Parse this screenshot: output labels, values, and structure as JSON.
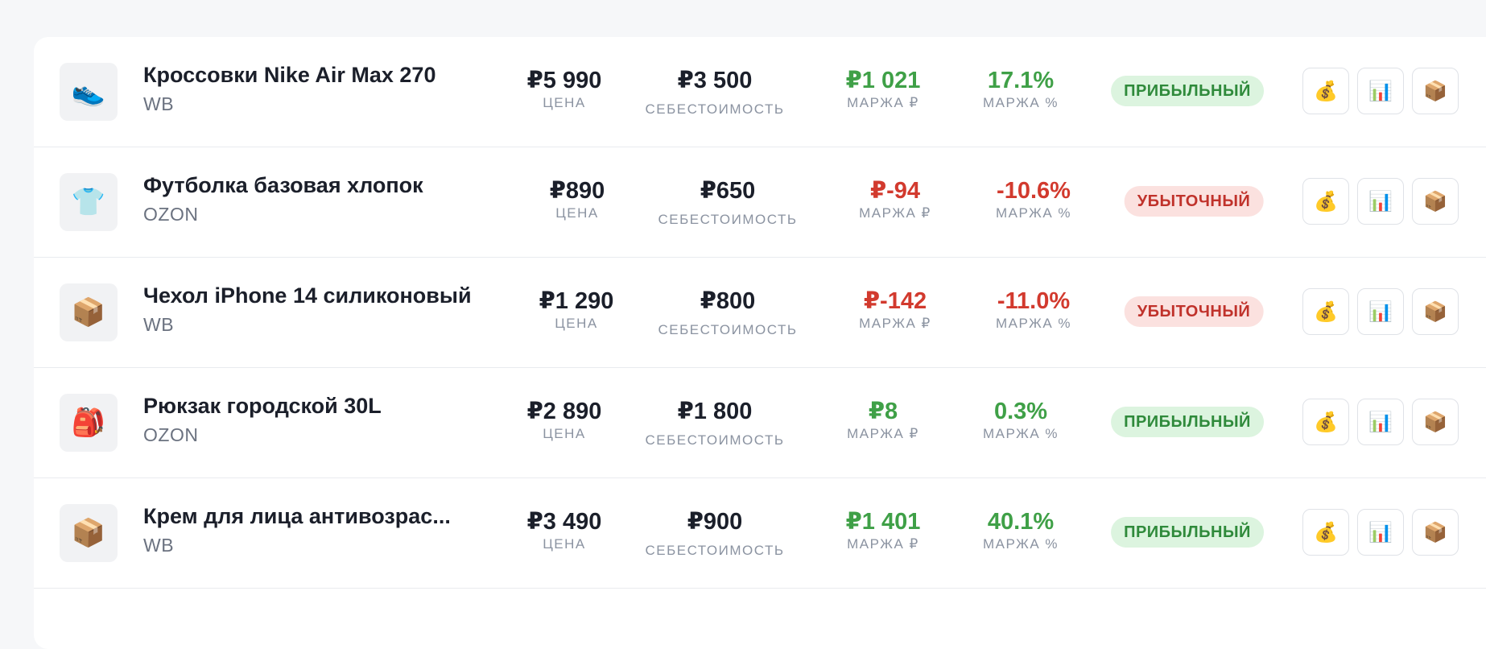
{
  "products": [
    {
      "icon": "sneaker-icon",
      "thumb": "👟",
      "name": "Кроссовки Nike Air Max 270",
      "platform": "WB",
      "price": "₽5 990",
      "price_label": "ЦЕНА",
      "cost": "₽3 500",
      "cost_label": "СЕБЕСТОИМОСТЬ",
      "margin_rub": "₽1 021",
      "margin_rub_label": "МАРЖА ₽",
      "margin_pct": "17.1%",
      "margin_pct_label": "МАРЖА %",
      "status": "ПРИБЫЛЬНЫЙ",
      "profitable": true
    },
    {
      "icon": "tshirt-icon",
      "thumb": "👕",
      "name": "Футболка базовая хлопок",
      "platform": "OZON",
      "price": "₽890",
      "price_label": "ЦЕНА",
      "cost": "₽650",
      "cost_label": "СЕБЕСТОИМОСТЬ",
      "margin_rub": "₽-94",
      "margin_rub_label": "МАРЖА ₽",
      "margin_pct": "-10.6%",
      "margin_pct_label": "МАРЖА %",
      "status": "УБЫТОЧНЫЙ",
      "profitable": false
    },
    {
      "icon": "package-icon",
      "thumb": "📦",
      "name": "Чехол iPhone 14 силиконовый",
      "platform": "WB",
      "price": "₽1 290",
      "price_label": "ЦЕНА",
      "cost": "₽800",
      "cost_label": "СЕБЕСТОИМОСТЬ",
      "margin_rub": "₽-142",
      "margin_rub_label": "МАРЖА ₽",
      "margin_pct": "-11.0%",
      "margin_pct_label": "МАРЖА %",
      "status": "УБЫТОЧНЫЙ",
      "profitable": false
    },
    {
      "icon": "backpack-icon",
      "thumb": "🎒",
      "name": "Рюкзак городской 30L",
      "platform": "OZON",
      "price": "₽2 890",
      "price_label": "ЦЕНА",
      "cost": "₽1 800",
      "cost_label": "СЕБЕСТОИМОСТЬ",
      "margin_rub": "₽8",
      "margin_rub_label": "МАРЖА ₽",
      "margin_pct": "0.3%",
      "margin_pct_label": "МАРЖА %",
      "status": "ПРИБЫЛЬНЫЙ",
      "profitable": true
    },
    {
      "icon": "package-icon",
      "thumb": "📦",
      "name": "Крем для лица антивозрас...",
      "platform": "WB",
      "price": "₽3 490",
      "price_label": "ЦЕНА",
      "cost": "₽900",
      "cost_label": "СЕБЕСТОИМОСТЬ",
      "margin_rub": "₽1 401",
      "margin_rub_label": "МАРЖА ₽",
      "margin_pct": "40.1%",
      "margin_pct_label": "МАРЖА %",
      "status": "ПРИБЫЛЬНЫЙ",
      "profitable": true
    }
  ],
  "actions": [
    {
      "icon": "money-bag-icon",
      "glyph": "💰"
    },
    {
      "icon": "bar-chart-icon",
      "glyph": "📊"
    },
    {
      "icon": "package-icon",
      "glyph": "📦"
    }
  ]
}
